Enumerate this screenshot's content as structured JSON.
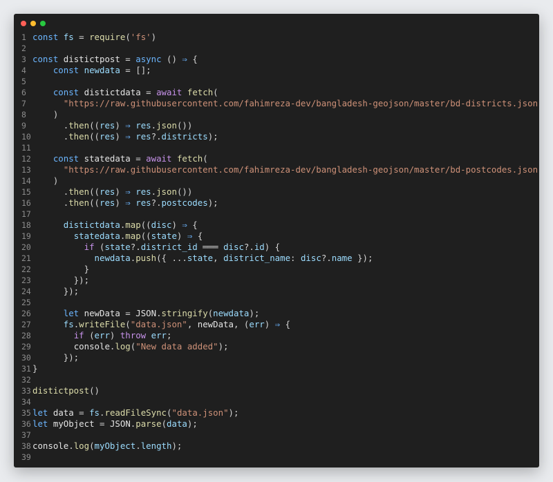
{
  "window": {
    "controls": [
      "close",
      "minimize",
      "maximize"
    ]
  },
  "colors": {
    "background": "#1f1f1f",
    "keyword": "#6cb6ff",
    "control_keyword": "#c792ea",
    "function": "#dcdcaa",
    "string": "#ce9178",
    "identifier": "#9cdcfe",
    "line_number": "#8c8c8c"
  },
  "code": {
    "lines": [
      {
        "n": "1",
        "tokens": [
          [
            "kw",
            "const"
          ],
          [
            "pun",
            " "
          ],
          [
            "var",
            "fs"
          ],
          [
            "op",
            " = "
          ],
          [
            "fn",
            "require"
          ],
          [
            "pun",
            "("
          ],
          [
            "str",
            "'fs'"
          ],
          [
            "pun",
            ")"
          ]
        ]
      },
      {
        "n": "2",
        "tokens": []
      },
      {
        "n": "3",
        "tokens": [
          [
            "kw",
            "const"
          ],
          [
            "pun",
            " "
          ],
          [
            "vard",
            "distictpost"
          ],
          [
            "op",
            " = "
          ],
          [
            "kw",
            "async"
          ],
          [
            "pun",
            " () "
          ],
          [
            "kw",
            "⇒"
          ],
          [
            "pun",
            " {"
          ]
        ]
      },
      {
        "n": "4",
        "tokens": [
          [
            "pun",
            "    "
          ],
          [
            "kw",
            "const"
          ],
          [
            "pun",
            " "
          ],
          [
            "var",
            "newdata"
          ],
          [
            "op",
            " = "
          ],
          [
            "pun",
            "[];"
          ]
        ]
      },
      {
        "n": "5",
        "tokens": []
      },
      {
        "n": "6",
        "tokens": [
          [
            "pun",
            "    "
          ],
          [
            "kw",
            "const"
          ],
          [
            "pun",
            " "
          ],
          [
            "vard",
            "distictdata"
          ],
          [
            "op",
            " = "
          ],
          [
            "kw2",
            "await"
          ],
          [
            "pun",
            " "
          ],
          [
            "fn",
            "fetch"
          ],
          [
            "pun",
            "("
          ]
        ]
      },
      {
        "n": "7",
        "tokens": [
          [
            "pun",
            "      "
          ],
          [
            "str",
            "\"https://raw.githubusercontent.com/fahimreza-dev/bangladesh-geojson/master/bd-districts.json\""
          ]
        ]
      },
      {
        "n": "8",
        "tokens": [
          [
            "pun",
            "    )"
          ]
        ]
      },
      {
        "n": "9",
        "tokens": [
          [
            "pun",
            "      ."
          ],
          [
            "fn",
            "then"
          ],
          [
            "pun",
            "(("
          ],
          [
            "var",
            "res"
          ],
          [
            "pun",
            ") "
          ],
          [
            "kw",
            "⇒"
          ],
          [
            "pun",
            " "
          ],
          [
            "var",
            "res"
          ],
          [
            "pun",
            "."
          ],
          [
            "fn",
            "json"
          ],
          [
            "pun",
            "())"
          ]
        ]
      },
      {
        "n": "10",
        "tokens": [
          [
            "pun",
            "      ."
          ],
          [
            "fn",
            "then"
          ],
          [
            "pun",
            "(("
          ],
          [
            "var",
            "res"
          ],
          [
            "pun",
            ") "
          ],
          [
            "kw",
            "⇒"
          ],
          [
            "pun",
            " "
          ],
          [
            "var",
            "res"
          ],
          [
            "pun",
            "?."
          ],
          [
            "var",
            "districts"
          ],
          [
            "pun",
            ");"
          ]
        ]
      },
      {
        "n": "11",
        "tokens": []
      },
      {
        "n": "12",
        "tokens": [
          [
            "pun",
            "    "
          ],
          [
            "kw",
            "const"
          ],
          [
            "pun",
            " "
          ],
          [
            "vard",
            "statedata"
          ],
          [
            "op",
            " = "
          ],
          [
            "kw2",
            "await"
          ],
          [
            "pun",
            " "
          ],
          [
            "fn",
            "fetch"
          ],
          [
            "pun",
            "("
          ]
        ]
      },
      {
        "n": "13",
        "tokens": [
          [
            "pun",
            "      "
          ],
          [
            "str",
            "\"https://raw.githubusercontent.com/fahimreza-dev/bangladesh-geojson/master/bd-postcodes.json\""
          ]
        ]
      },
      {
        "n": "14",
        "tokens": [
          [
            "pun",
            "    )"
          ]
        ]
      },
      {
        "n": "15",
        "tokens": [
          [
            "pun",
            "      ."
          ],
          [
            "fn",
            "then"
          ],
          [
            "pun",
            "(("
          ],
          [
            "var",
            "res"
          ],
          [
            "pun",
            ") "
          ],
          [
            "kw",
            "⇒"
          ],
          [
            "pun",
            " "
          ],
          [
            "var",
            "res"
          ],
          [
            "pun",
            "."
          ],
          [
            "fn",
            "json"
          ],
          [
            "pun",
            "())"
          ]
        ]
      },
      {
        "n": "16",
        "tokens": [
          [
            "pun",
            "      ."
          ],
          [
            "fn",
            "then"
          ],
          [
            "pun",
            "(("
          ],
          [
            "var",
            "res"
          ],
          [
            "pun",
            ") "
          ],
          [
            "kw",
            "⇒"
          ],
          [
            "pun",
            " "
          ],
          [
            "var",
            "res"
          ],
          [
            "pun",
            "?."
          ],
          [
            "var",
            "postcodes"
          ],
          [
            "pun",
            ");"
          ]
        ]
      },
      {
        "n": "17",
        "tokens": []
      },
      {
        "n": "18",
        "tokens": [
          [
            "pun",
            "      "
          ],
          [
            "var",
            "distictdata"
          ],
          [
            "pun",
            "."
          ],
          [
            "fn",
            "map"
          ],
          [
            "pun",
            "(("
          ],
          [
            "var",
            "disc"
          ],
          [
            "pun",
            ") "
          ],
          [
            "kw",
            "⇒"
          ],
          [
            "pun",
            " {"
          ]
        ]
      },
      {
        "n": "19",
        "tokens": [
          [
            "pun",
            "        "
          ],
          [
            "var",
            "statedata"
          ],
          [
            "pun",
            "."
          ],
          [
            "fn",
            "map"
          ],
          [
            "pun",
            "(("
          ],
          [
            "var",
            "state"
          ],
          [
            "pun",
            ") "
          ],
          [
            "kw",
            "⇒"
          ],
          [
            "pun",
            " {"
          ]
        ]
      },
      {
        "n": "20",
        "tokens": [
          [
            "pun",
            "          "
          ],
          [
            "kw2",
            "if"
          ],
          [
            "pun",
            " ("
          ],
          [
            "var",
            "state"
          ],
          [
            "pun",
            "?."
          ],
          [
            "var",
            "district_id"
          ],
          [
            "op",
            " ═══ "
          ],
          [
            "var",
            "disc"
          ],
          [
            "pun",
            "?."
          ],
          [
            "var",
            "id"
          ],
          [
            "pun",
            ") {"
          ]
        ]
      },
      {
        "n": "21",
        "tokens": [
          [
            "pun",
            "            "
          ],
          [
            "var",
            "newdata"
          ],
          [
            "pun",
            "."
          ],
          [
            "fn",
            "push"
          ],
          [
            "pun",
            "({ ..."
          ],
          [
            "var",
            "state"
          ],
          [
            "pun",
            ", "
          ],
          [
            "var",
            "district_name"
          ],
          [
            "pun",
            ": "
          ],
          [
            "var",
            "disc"
          ],
          [
            "pun",
            "?."
          ],
          [
            "var",
            "name"
          ],
          [
            "pun",
            " });"
          ]
        ]
      },
      {
        "n": "22",
        "tokens": [
          [
            "pun",
            "          }"
          ]
        ]
      },
      {
        "n": "23",
        "tokens": [
          [
            "pun",
            "        });"
          ]
        ]
      },
      {
        "n": "24",
        "tokens": [
          [
            "pun",
            "      });"
          ]
        ]
      },
      {
        "n": "25",
        "tokens": []
      },
      {
        "n": "26",
        "tokens": [
          [
            "pun",
            "      "
          ],
          [
            "kw",
            "let"
          ],
          [
            "pun",
            " "
          ],
          [
            "vard",
            "newData"
          ],
          [
            "op",
            " = "
          ],
          [
            "vard",
            "JSON"
          ],
          [
            "pun",
            "."
          ],
          [
            "fn",
            "stringify"
          ],
          [
            "pun",
            "("
          ],
          [
            "var",
            "newdata"
          ],
          [
            "pun",
            ");"
          ]
        ]
      },
      {
        "n": "27",
        "tokens": [
          [
            "pun",
            "      "
          ],
          [
            "var",
            "fs"
          ],
          [
            "pun",
            "."
          ],
          [
            "fn",
            "writeFile"
          ],
          [
            "pun",
            "("
          ],
          [
            "str",
            "\"data.json\""
          ],
          [
            "pun",
            ", "
          ],
          [
            "vard",
            "newData"
          ],
          [
            "pun",
            ", ("
          ],
          [
            "var",
            "err"
          ],
          [
            "pun",
            ") "
          ],
          [
            "kw",
            "⇒"
          ],
          [
            "pun",
            " {"
          ]
        ]
      },
      {
        "n": "28",
        "tokens": [
          [
            "pun",
            "        "
          ],
          [
            "kw2",
            "if"
          ],
          [
            "pun",
            " ("
          ],
          [
            "var",
            "err"
          ],
          [
            "pun",
            ") "
          ],
          [
            "kw2",
            "throw"
          ],
          [
            "pun",
            " "
          ],
          [
            "var",
            "err"
          ],
          [
            "pun",
            ";"
          ]
        ]
      },
      {
        "n": "29",
        "tokens": [
          [
            "pun",
            "        "
          ],
          [
            "vard",
            "console"
          ],
          [
            "pun",
            "."
          ],
          [
            "fn",
            "log"
          ],
          [
            "pun",
            "("
          ],
          [
            "str",
            "\"New data added\""
          ],
          [
            "pun",
            ");"
          ]
        ]
      },
      {
        "n": "30",
        "tokens": [
          [
            "pun",
            "      });"
          ]
        ]
      },
      {
        "n": "31",
        "tokens": [
          [
            "pun",
            "}"
          ]
        ]
      },
      {
        "n": "32",
        "tokens": []
      },
      {
        "n": "33",
        "tokens": [
          [
            "fn",
            "distictpost"
          ],
          [
            "pun",
            "()"
          ]
        ]
      },
      {
        "n": "34",
        "tokens": []
      },
      {
        "n": "35",
        "tokens": [
          [
            "kw",
            "let"
          ],
          [
            "pun",
            " "
          ],
          [
            "vard",
            "data"
          ],
          [
            "op",
            " = "
          ],
          [
            "var",
            "fs"
          ],
          [
            "pun",
            "."
          ],
          [
            "fn",
            "readFileSync"
          ],
          [
            "pun",
            "("
          ],
          [
            "str",
            "\"data.json\""
          ],
          [
            "pun",
            ");"
          ]
        ]
      },
      {
        "n": "36",
        "tokens": [
          [
            "kw",
            "let"
          ],
          [
            "pun",
            " "
          ],
          [
            "vard",
            "myObject"
          ],
          [
            "op",
            " = "
          ],
          [
            "vard",
            "JSON"
          ],
          [
            "pun",
            "."
          ],
          [
            "fn",
            "parse"
          ],
          [
            "pun",
            "("
          ],
          [
            "var",
            "data"
          ],
          [
            "pun",
            ");"
          ]
        ]
      },
      {
        "n": "37",
        "tokens": []
      },
      {
        "n": "38",
        "tokens": [
          [
            "vard",
            "console"
          ],
          [
            "pun",
            "."
          ],
          [
            "fn",
            "log"
          ],
          [
            "pun",
            "("
          ],
          [
            "var",
            "myObject"
          ],
          [
            "pun",
            "."
          ],
          [
            "var",
            "length"
          ],
          [
            "pun",
            ");"
          ]
        ]
      },
      {
        "n": "39",
        "tokens": []
      }
    ]
  }
}
